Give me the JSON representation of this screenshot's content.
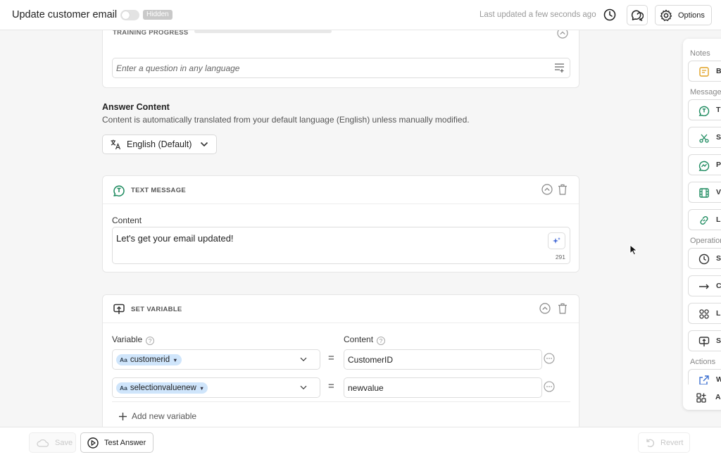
{
  "header": {
    "title": "Update customer email",
    "visibility_badge": "Hidden",
    "last_updated": "Last updated a few seconds ago",
    "options_label": "Options"
  },
  "training": {
    "label": "TRAINING PROGRESS",
    "question_placeholder": "Enter a question in any language"
  },
  "answer": {
    "title": "Answer Content",
    "description": "Content is automatically translated from your default language (English) unless manually modified.",
    "language": "English (Default)"
  },
  "text_message": {
    "label": "TEXT MESSAGE",
    "content_label": "Content",
    "content": "Let's get your email updated!",
    "char_count": "291"
  },
  "set_variable": {
    "label": "SET VARIABLE",
    "variable_label": "Variable",
    "content_label": "Content",
    "chip_prefix": "Aa",
    "rows": [
      {
        "variable": "customerid",
        "value": "CustomerID"
      },
      {
        "variable": "selectionvaluenew",
        "value": "newvalue"
      }
    ],
    "add_label": "Add new variable"
  },
  "panel": {
    "headings": [
      "Notes",
      "Messages",
      "Operations",
      "Actions"
    ],
    "items": [
      {
        "icon": "note-icon",
        "text": "B"
      },
      {
        "icon": "text-message-icon",
        "text": "T"
      },
      {
        "icon": "scissors-icon",
        "text": "S"
      },
      {
        "icon": "picture-icon",
        "text": "P"
      },
      {
        "icon": "video-icon",
        "text": "V"
      },
      {
        "icon": "link-icon",
        "text": "Li"
      },
      {
        "icon": "clock-icon",
        "text": "S"
      },
      {
        "icon": "arrow-right-icon",
        "text": "C"
      },
      {
        "icon": "grid-icon",
        "text": "Li"
      },
      {
        "icon": "set-variable-icon",
        "text": "S"
      },
      {
        "icon": "external-link-icon",
        "text": "W"
      },
      {
        "icon": "apps-icon",
        "text": "A"
      }
    ]
  },
  "footer": {
    "save_label": "Save",
    "test_label": "Test Answer",
    "revert_label": "Revert"
  },
  "colors": {
    "accent_green": "#1c8a5e",
    "chip_blue": "#cfe5fb",
    "note_yellow": "#e0a020"
  }
}
